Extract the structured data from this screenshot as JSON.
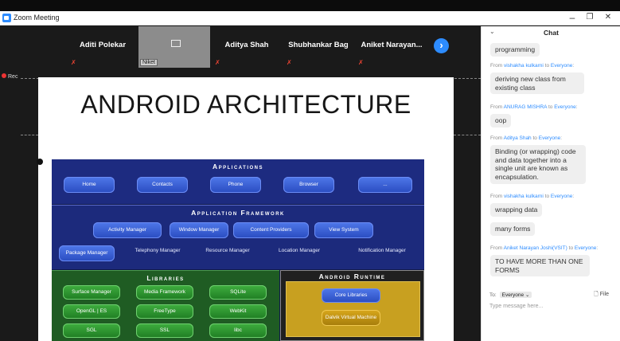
{
  "window": {
    "title": "Zoom Meeting",
    "minimize": "–",
    "restore": "❐",
    "close": "✕"
  },
  "participants": [
    {
      "name": "Aditi Polekar",
      "active": false
    },
    {
      "name": "Niket",
      "active": true
    },
    {
      "name": "Aditya Shah",
      "active": false
    },
    {
      "name": "Shubhankar Bag",
      "active": false
    },
    {
      "name": "Aniket  Narayan...",
      "active": false
    }
  ],
  "strip": {
    "next_icon": "›",
    "mic_icon": "✗"
  },
  "recording": {
    "label": "Rec"
  },
  "slide": {
    "title": "ANDROID ARCHITECTURE",
    "layers": {
      "applications": {
        "heading": "Applications",
        "items": [
          "Home",
          "Contacts",
          "Phone",
          "Browser",
          "..."
        ]
      },
      "framework": {
        "heading": "Application Framework",
        "row1": [
          "Activity Manager",
          "Window Manager",
          "Content Providers",
          "View System"
        ],
        "row2": [
          "Package Manager",
          "Telephony Manager",
          "Resource Manager",
          "Location Manager",
          "Notification Manager"
        ]
      },
      "libraries": {
        "heading": "Libraries",
        "items": [
          "Surface Manager",
          "Media Framework",
          "SQLite",
          "OpenGL | ES",
          "FreeType",
          "WebKit",
          "SGL",
          "SSL",
          "libc"
        ]
      },
      "runtime": {
        "heading": "Android Runtime",
        "items": [
          "Core Libraries",
          "Dalvik Virtual Machine"
        ]
      }
    }
  },
  "chat": {
    "title": "Chat",
    "collapse_icon": "⌄",
    "messages": [
      {
        "from": "",
        "to": "",
        "texts": [
          "programming"
        ]
      },
      {
        "from": "vishakha kulkarni",
        "to": "Everyone",
        "texts": [
          "deriving new class from existing class"
        ]
      },
      {
        "from": "ANURAG MISHRA",
        "to": "Everyone",
        "texts": [
          "oop"
        ]
      },
      {
        "from": "Aditya Shah",
        "to": "Everyone",
        "texts": [
          "Binding (or wrapping) code and data together into a single unit are known as encapsulation."
        ]
      },
      {
        "from": "vishakha kulkarni",
        "to": "Everyone",
        "texts": [
          "wrapping data",
          "many forms"
        ]
      },
      {
        "from": "Aniket Narayan Joshi(VSIT)",
        "to": "Everyone",
        "texts": [
          "TO HAVE MORE THAN ONE FORMS"
        ]
      }
    ],
    "from_prefix": "From",
    "to_word": "to",
    "recipient_label": "To:",
    "recipient_value": "Everyone ⌄",
    "file_label": "File",
    "input_placeholder": "Type message here..."
  }
}
